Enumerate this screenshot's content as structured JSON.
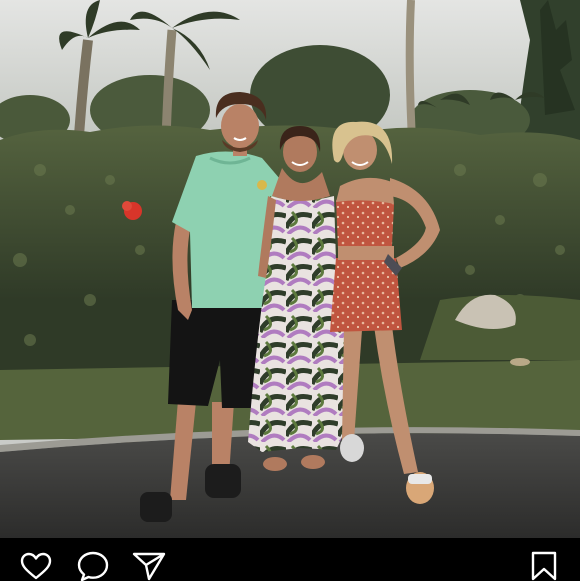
{
  "post": {
    "photo_alt": "",
    "colors": {
      "sky": "#cfd1cf",
      "hedge": "#3d4a33",
      "lawn": "#4f5e3a",
      "pavement": "#3a3a39",
      "action_bar": "#000000",
      "icon_stroke": "#ffffff"
    }
  },
  "actions": {
    "like_icon": "heart-icon",
    "comment_icon": "comment-bubble-icon",
    "share_icon": "paper-plane-icon",
    "save_icon": "bookmark-icon"
  }
}
